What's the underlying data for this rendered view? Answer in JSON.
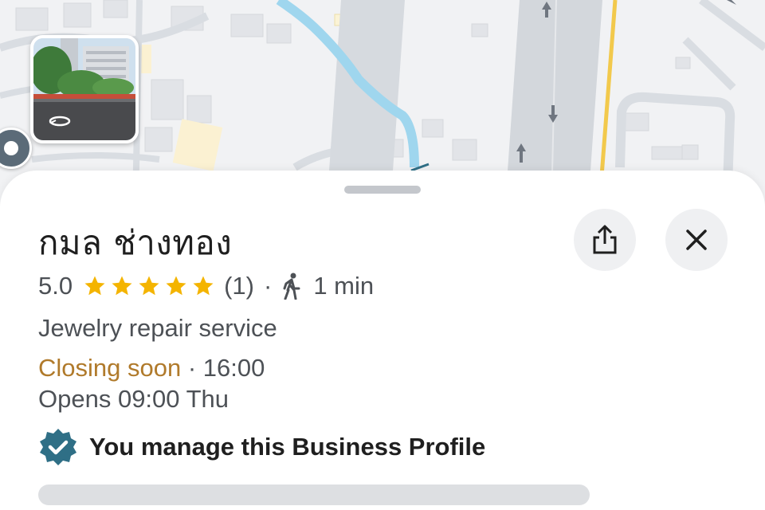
{
  "place": {
    "name": "กมล ช่างทอง",
    "rating": "5.0",
    "stars": 5,
    "review_count": "(1)",
    "separator": "·",
    "walk_time": "1 min",
    "category": "Jewelry repair service",
    "status": "Closing soon",
    "status_separator": " · ",
    "closing_time": "16:00",
    "opens": "Opens 09:00 Thu",
    "manage_text": "You manage this Business Profile"
  },
  "icons": {
    "share": "share-icon",
    "close": "close-icon",
    "walk": "walking-person-icon",
    "star": "star-icon",
    "verified": "verified-badge-icon",
    "street_view_rotate": "rotate-360-icon"
  },
  "colors": {
    "star": "#f4b400",
    "closing": "#b07a2b",
    "verified": "#2f6f86",
    "river": "#9fd6ee",
    "road_yellow": "#f2c94c"
  }
}
